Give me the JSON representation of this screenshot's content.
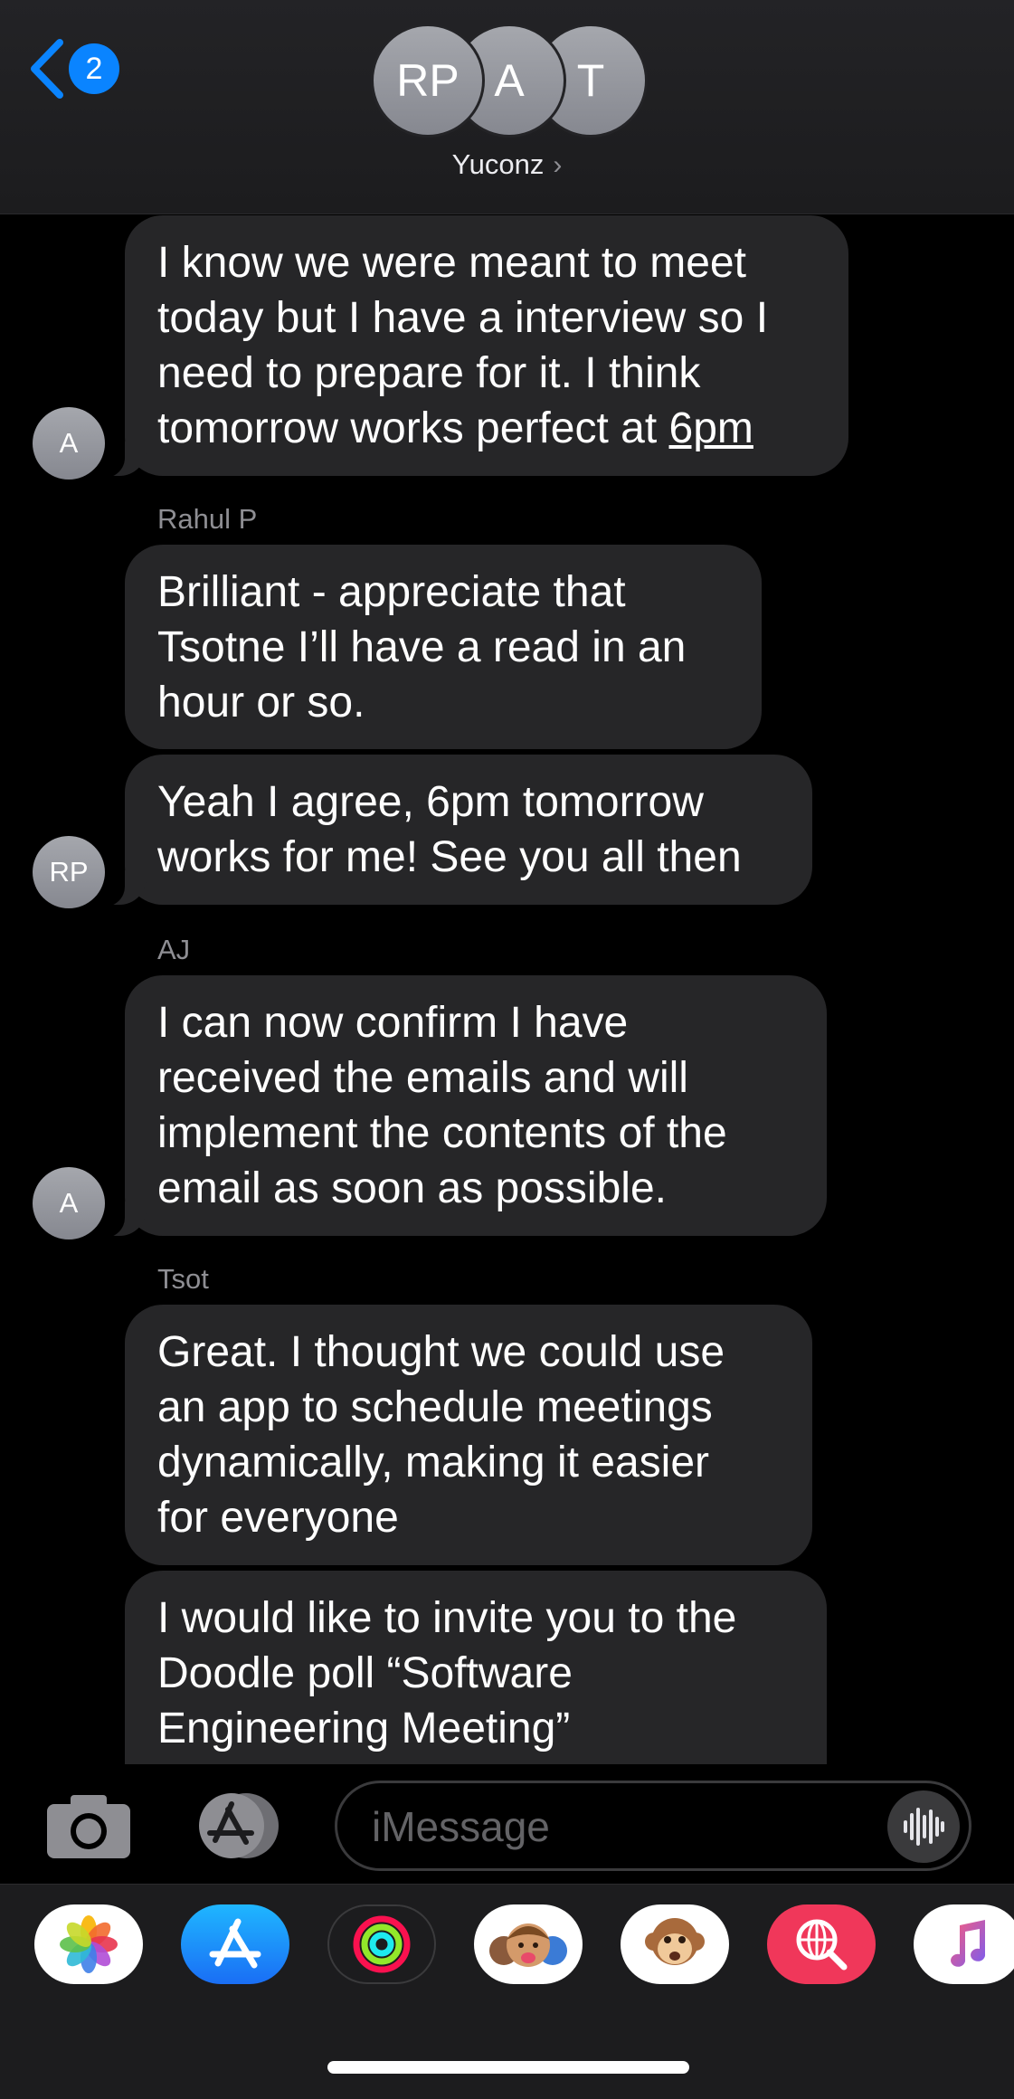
{
  "header": {
    "back_badge": "2",
    "avatars": [
      "RP",
      "A",
      "T"
    ],
    "group_name": "Yuconz",
    "chevron": "›"
  },
  "messages": [
    {
      "avatar": "A",
      "lines": [
        "I know we were meant to meet",
        "today but I have a interview so I",
        "need to prepare for it. I think"
      ],
      "last_line_prefix": "tomorrow works perfect at ",
      "last_line_link": "6pm"
    },
    {
      "sender": "Rahul P",
      "lines": [
        "Brilliant - appreciate that",
        "Tsotne I’ll have a read in an",
        "hour or so."
      ]
    },
    {
      "avatar": "RP",
      "lines": [
        "Yeah I agree, 6pm tomorrow",
        "works for me! See you all then"
      ]
    },
    {
      "sender": "AJ",
      "avatar": "A",
      "lines": [
        "I can now confirm I have",
        "received the emails and will",
        "implement the contents of the",
        "email as soon as possible."
      ]
    },
    {
      "sender": "Tsot",
      "lines": [
        "Great. I thought we could use",
        "an app to schedule meetings",
        "dynamically, making it easier",
        "for everyone"
      ]
    },
    {
      "lines": [
        "I would like to invite you to the",
        "Doodle poll “Software",
        "Engineering Meeting”"
      ]
    }
  ],
  "input": {
    "placeholder": "iMessage"
  },
  "apps": [
    "photos-app",
    "app-store-app",
    "activity-app",
    "memoji-app",
    "animoji-app",
    "search-images-app",
    "music-app"
  ],
  "colors": {
    "bubble": "#262628",
    "accent": "#0a84ff",
    "background": "#000000"
  }
}
